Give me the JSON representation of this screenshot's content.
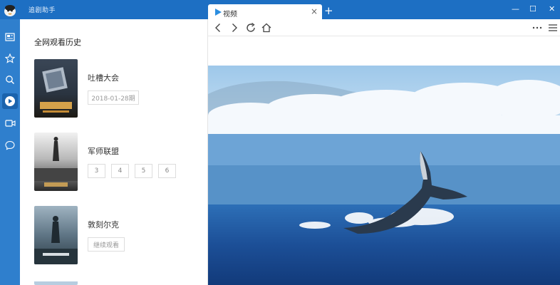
{
  "app": {
    "title": "追剧助手"
  },
  "tab": {
    "label": "视频",
    "close_glyph": "×"
  },
  "new_tab_glyph": "+",
  "window_controls": {
    "minimize": "—",
    "maximize": "☐",
    "close": "✕"
  },
  "history": {
    "title": "全网观看历史",
    "items": [
      {
        "title": "吐槽大会",
        "chip": "2018-01-28期"
      },
      {
        "title": "军师联盟",
        "episodes": [
          "3",
          "4",
          "5",
          "6"
        ]
      },
      {
        "title": "敦刻尔克",
        "chip": "继续观看"
      }
    ]
  },
  "icons": {
    "rail": [
      "news-icon",
      "star-icon",
      "search-icon",
      "play-icon",
      "video-camera-icon",
      "chat-icon"
    ],
    "active_rail": "play-icon",
    "toolbar": [
      "back-icon",
      "forward-icon",
      "refresh-icon",
      "home-icon",
      "more-icon",
      "menu-icon"
    ]
  },
  "colors": {
    "titlebar": "#1d6fc3",
    "rail": "#2f7fcd",
    "accent": "#2b8ee0"
  }
}
